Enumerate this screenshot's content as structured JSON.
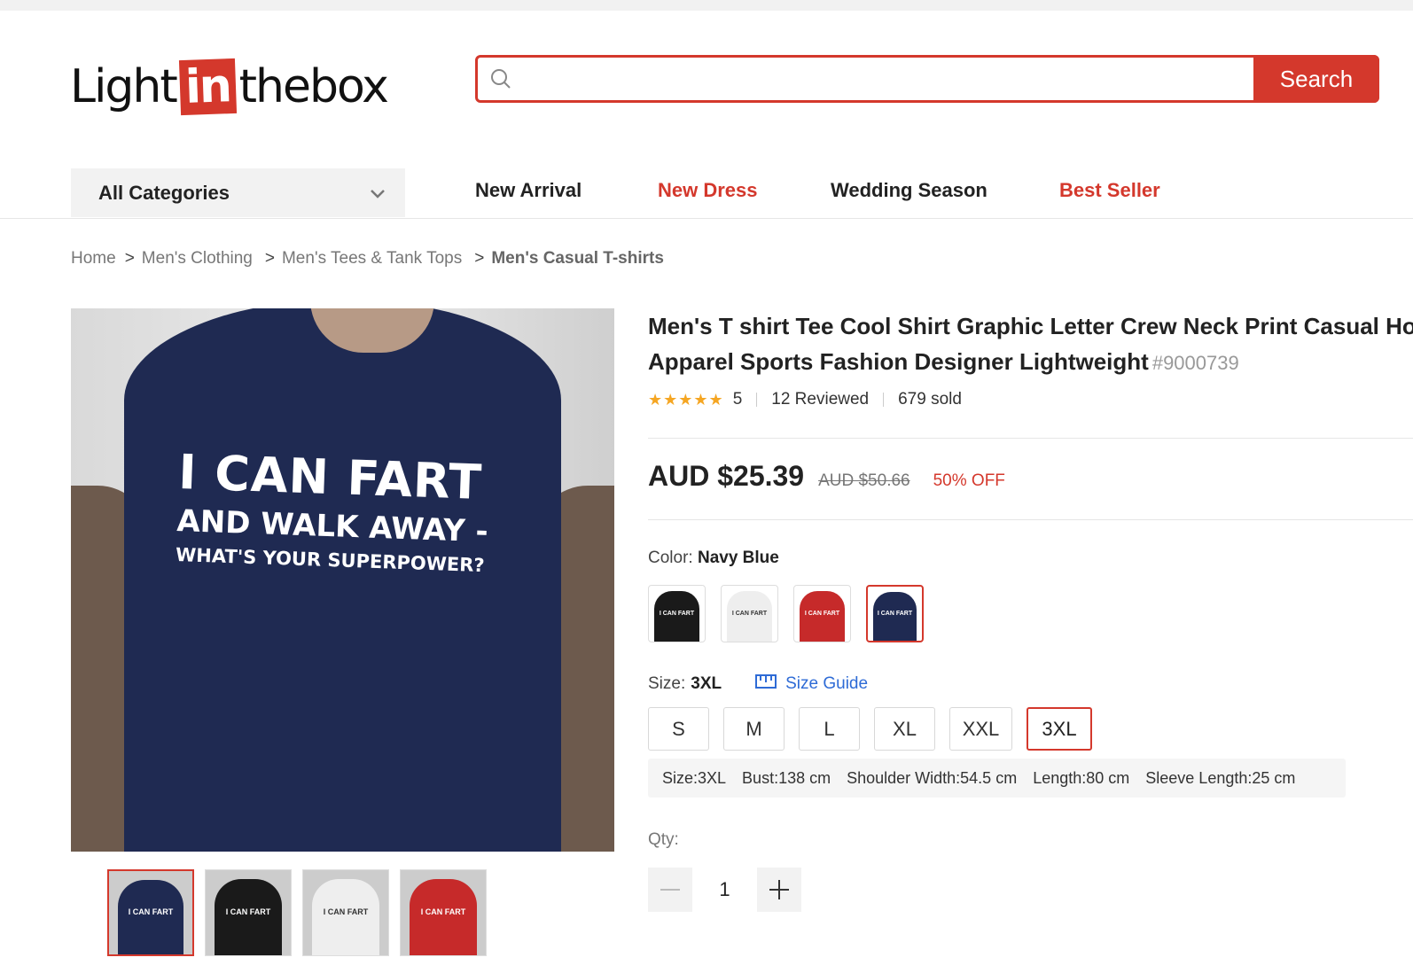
{
  "logo": {
    "part1": "Light",
    "part2": "in",
    "part3": "thebox"
  },
  "search": {
    "placeholder": "",
    "button_label": "Search"
  },
  "nav": {
    "categories_label": "All Categories",
    "items": [
      {
        "label": "New Arrival",
        "color": "#222222"
      },
      {
        "label": "New Dress",
        "color": "#d4382c"
      },
      {
        "label": "Wedding Season",
        "color": "#222222"
      },
      {
        "label": "Best Seller",
        "color": "#d4382c"
      }
    ]
  },
  "breadcrumb": {
    "items": [
      "Home",
      "Men's Clothing",
      "Men's Tees & Tank Tops",
      "Men's Casual T-shirts"
    ],
    "separator": ">"
  },
  "product": {
    "title_line1": "Men's T shirt Tee Cool Shirt Graphic Letter Crew Neck Print Casual Holi",
    "title_line2": "Apparel Sports Fashion Designer Lightweight",
    "sku": "#9000739",
    "rating": "5",
    "reviews": "12 Reviewed",
    "sold": "679 sold",
    "price": "AUD $25.39",
    "original_price": "AUD $50.66",
    "discount": "50% OFF",
    "print": {
      "line1": "I CAN FART",
      "line2": "AND WALK AWAY -",
      "line3": "WHAT'S YOUR SUPERPOWER?"
    }
  },
  "color": {
    "label": "Color:",
    "selected": "Navy Blue",
    "options": [
      {
        "name": "Black",
        "hex": "#1a1a1a",
        "text_hex": "#ffffff"
      },
      {
        "name": "White",
        "hex": "#eeeeee",
        "text_hex": "#333333"
      },
      {
        "name": "Red",
        "hex": "#c62a2a",
        "text_hex": "#ffffff"
      },
      {
        "name": "Navy Blue",
        "hex": "#1f2a52",
        "text_hex": "#ffffff"
      }
    ]
  },
  "size": {
    "label": "Size:",
    "selected": "3XL",
    "guide_label": "Size Guide",
    "options": [
      "S",
      "M",
      "L",
      "XL",
      "XXL",
      "3XL"
    ],
    "details": [
      "Size:3XL",
      "Bust:138 cm",
      "Shoulder Width:54.5 cm",
      "Length:80 cm",
      "Sleeve Length:25 cm"
    ]
  },
  "qty": {
    "label": "Qty:",
    "value": "1"
  },
  "thumbs": [
    {
      "hex": "#1f2a52",
      "text_hex": "#ffffff"
    },
    {
      "hex": "#1a1a1a",
      "text_hex": "#ffffff"
    },
    {
      "hex": "#eeeeee",
      "text_hex": "#333333"
    },
    {
      "hex": "#c62a2a",
      "text_hex": "#ffffff"
    }
  ]
}
